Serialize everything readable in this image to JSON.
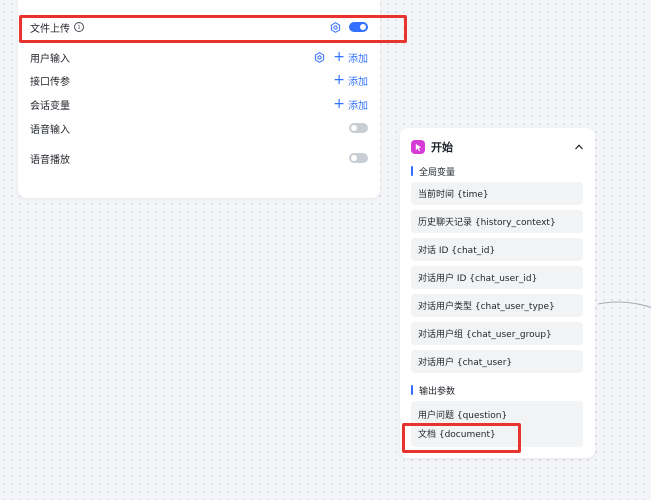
{
  "settings": {
    "rows": [
      {
        "label": "文件上传"
      },
      {
        "label": "用户输入",
        "action": "添加"
      },
      {
        "label": "接口传参",
        "action": "添加"
      },
      {
        "label": "会话变量",
        "action": "添加"
      },
      {
        "label": "语音输入"
      },
      {
        "label": "语音播放"
      }
    ],
    "info_glyph": "i",
    "plus_glyph": "+"
  },
  "start_node": {
    "title": "开始",
    "global_vars_title": "全局变量",
    "global_vars": [
      "当前时间 {time}",
      "历史聊天记录 {history_context}",
      "对话 ID {chat_id}",
      "对话用户 ID {chat_user_id}",
      "对话用户类型 {chat_user_type}",
      "对话用户组 {chat_user_group}",
      "对话用户 {chat_user}"
    ],
    "output_params_title": "输出参数",
    "output_params": [
      "用户问题 {question}",
      "文档 {document}"
    ]
  },
  "colors": {
    "accent": "#3370ff",
    "highlight": "#e8342f",
    "node_icon": "#d63bd8"
  },
  "toggles": {
    "file_upload": true,
    "voice_input": false,
    "voice_playback": false
  }
}
